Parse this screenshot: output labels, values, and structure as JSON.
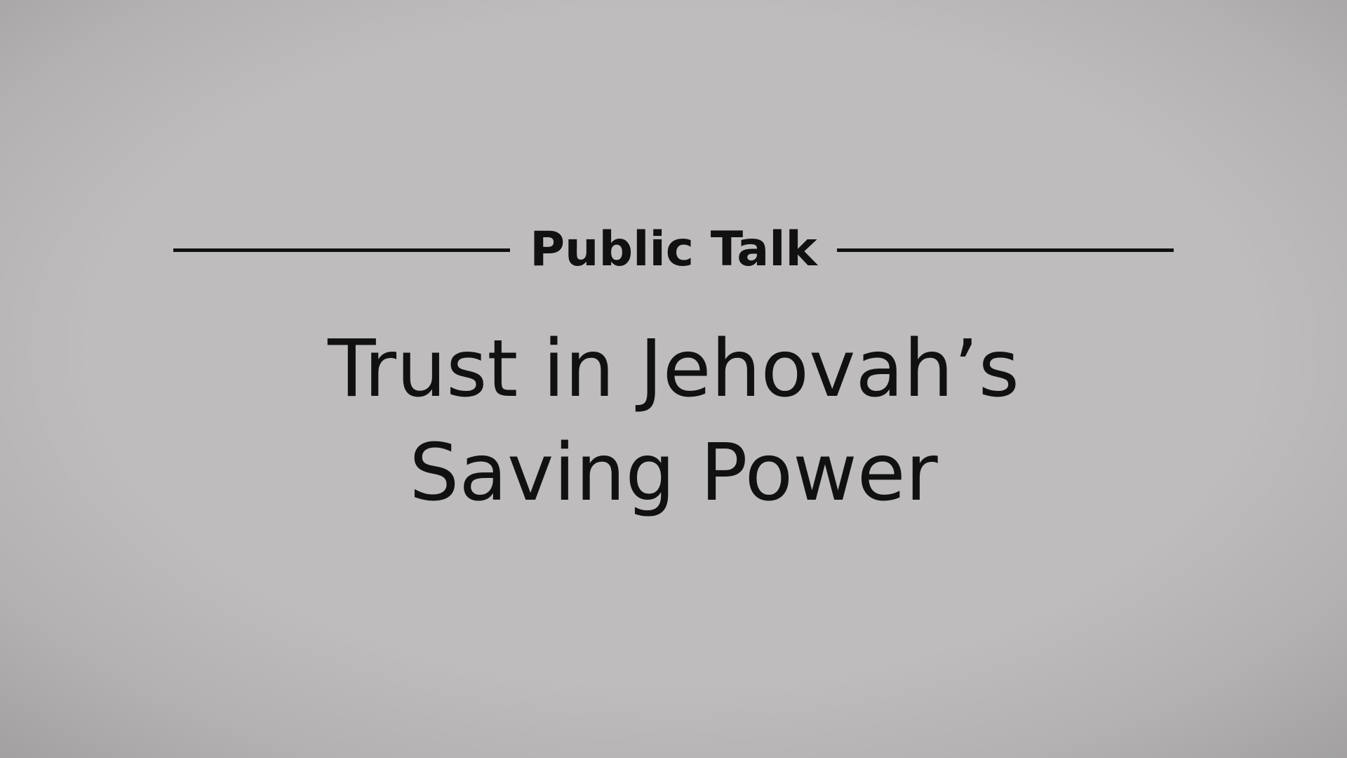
{
  "slide": {
    "label": "Public Talk",
    "title_line1": "Trust in Jehovah’s",
    "title_line2": "Saving Power"
  },
  "colors": {
    "background": "#bebcbc",
    "text": "#111111",
    "rule": "#111111"
  }
}
